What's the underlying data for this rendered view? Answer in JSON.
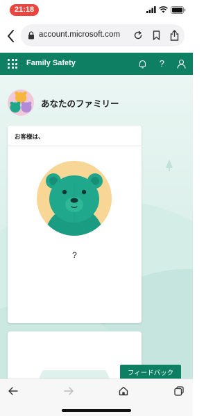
{
  "status_bar": {
    "time": "21:18"
  },
  "browser": {
    "url": "account.microsoft.com"
  },
  "app_header": {
    "title": "Family Safety"
  },
  "family": {
    "title": "あなたのファミリー"
  },
  "card": {
    "heading": "お客様は、",
    "name": "?"
  },
  "feedback": {
    "label": "フィードバック"
  },
  "colors": {
    "brand_green": "#0e7f63",
    "time_pill": "#e8463f",
    "bear_green": "#1fa58a",
    "bear_bg": "#f8d696"
  },
  "icons": [
    "back-icon",
    "lock-icon",
    "reload-icon",
    "bookmark-icon",
    "share-icon",
    "waffle-icon",
    "bell-icon",
    "help-icon",
    "person-icon",
    "home-icon",
    "tabs-icon",
    "forward-icon"
  ]
}
